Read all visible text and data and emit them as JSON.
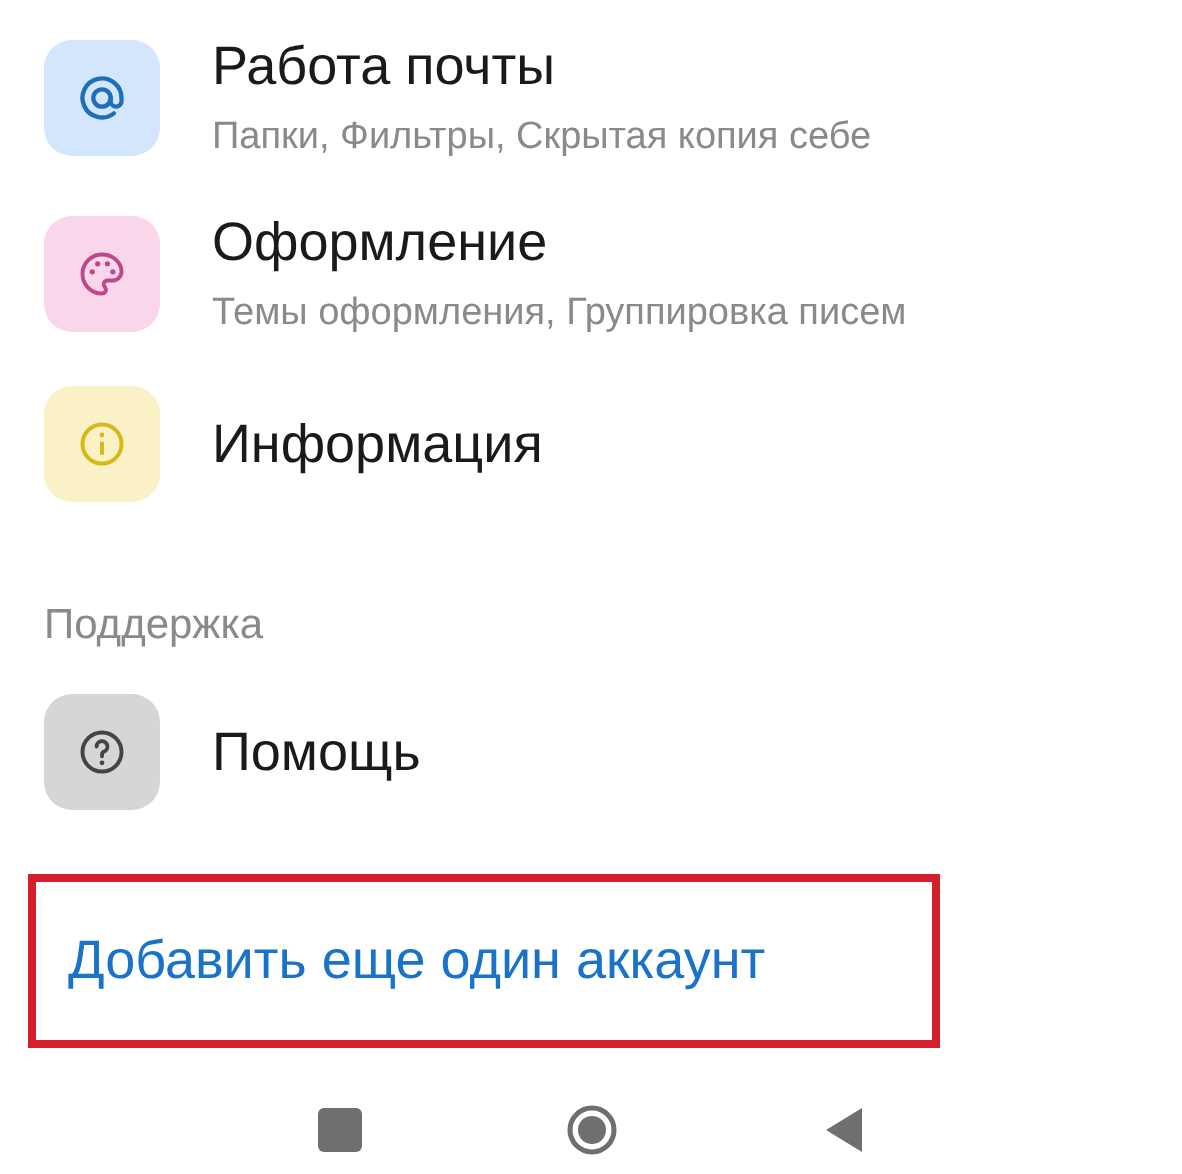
{
  "settings": [
    {
      "title": "Работа почты",
      "subtitle": "Папки, Фильтры, Скрытая копия себе"
    },
    {
      "title": "Оформление",
      "subtitle": "Темы оформления, Группировка писем"
    },
    {
      "title": "Информация"
    }
  ],
  "support": {
    "header": "Поддержка",
    "items": [
      {
        "title": "Помощь"
      }
    ]
  },
  "add_account": {
    "label": "Добавить еще один аккаунт",
    "highlighted": true
  }
}
